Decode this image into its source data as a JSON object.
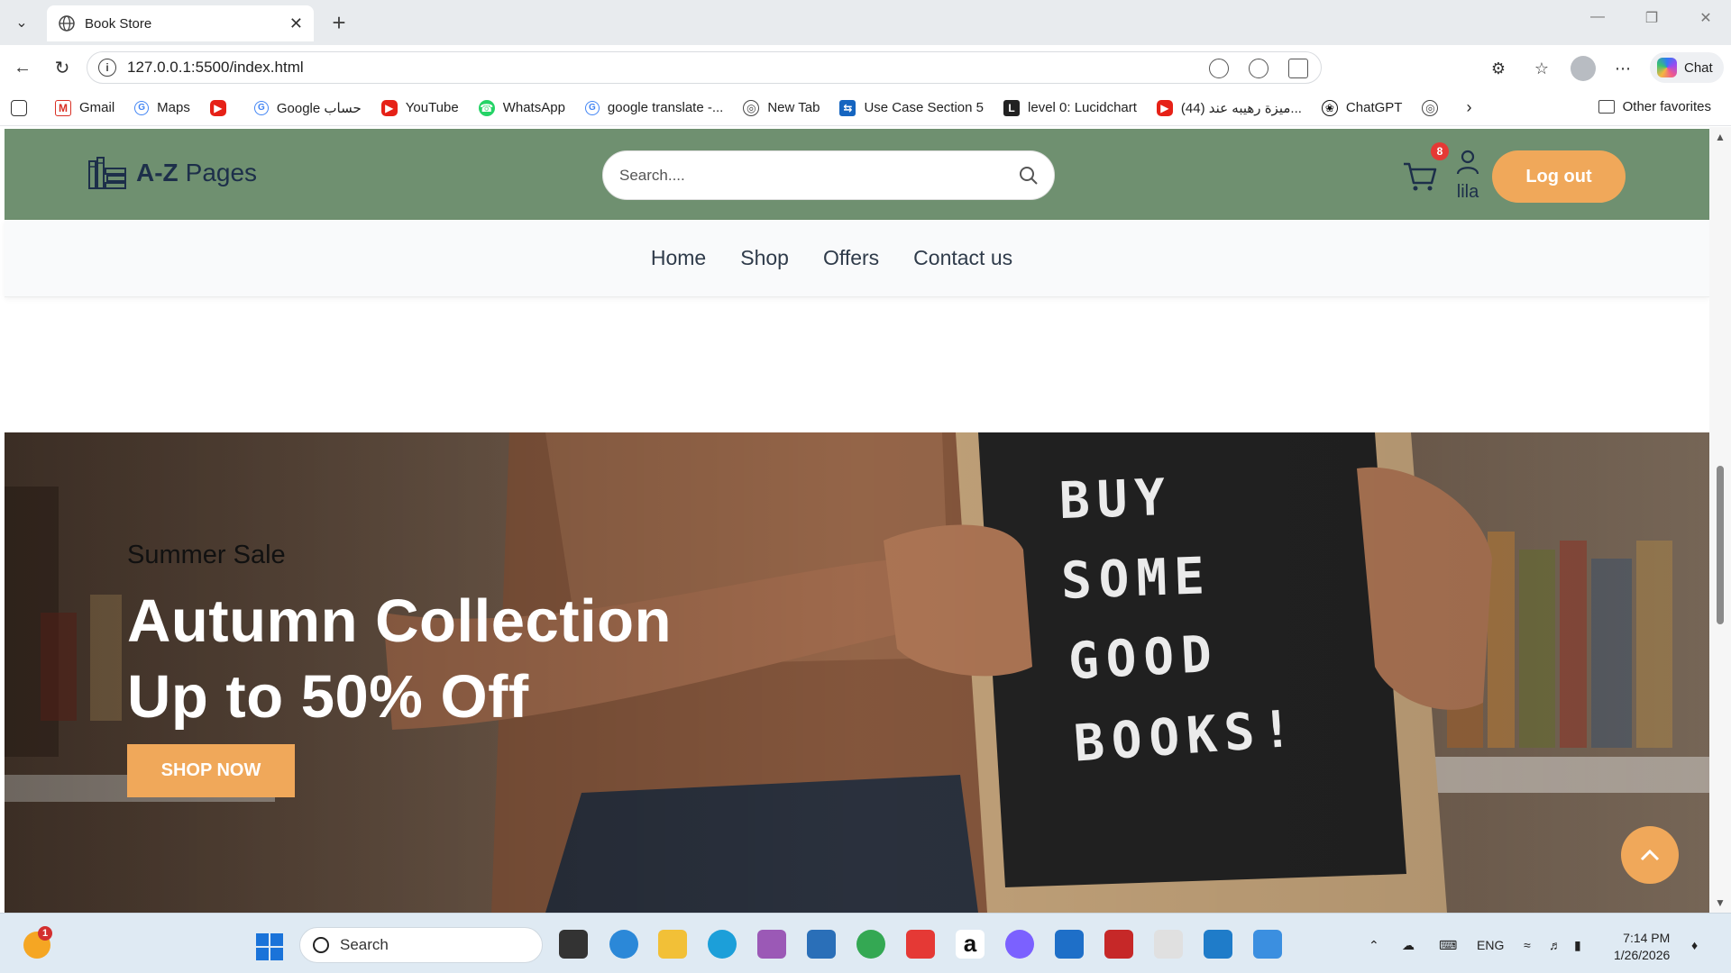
{
  "browser": {
    "tab_title": "Book Store",
    "url": "127.0.0.1:5500/index.html",
    "chat_label": "Chat",
    "bookmarks": [
      {
        "label": "Gmail",
        "icon": "gmail-icon"
      },
      {
        "label": "Maps",
        "icon": "google-icon"
      },
      {
        "label": "",
        "icon": "youtube-icon"
      },
      {
        "label": "Google حساب",
        "icon": "google-icon"
      },
      {
        "label": "YouTube",
        "icon": "youtube-icon"
      },
      {
        "label": "WhatsApp",
        "icon": "whatsapp-icon"
      },
      {
        "label": "google translate -...",
        "icon": "google-icon"
      },
      {
        "label": "New Tab",
        "icon": "globe-icon"
      },
      {
        "label": "Use Case Section 5",
        "icon": "usecase-icon"
      },
      {
        "label": "level 0: Lucidchart",
        "icon": "lucidchart-icon"
      },
      {
        "label": "(44) ميزة رهيبه عند...",
        "icon": "youtube-icon"
      },
      {
        "label": "ChatGPT",
        "icon": "chatgpt-icon"
      },
      {
        "label": "",
        "icon": "globe-icon"
      }
    ],
    "other_favorites": "Other favorites"
  },
  "site": {
    "brand_a": "A-Z",
    "brand_b": "Pages",
    "search_placeholder": "Search....",
    "cart_count": "8",
    "username": "lila",
    "logout_label": "Log out",
    "nav": [
      "Home",
      "Shop",
      "Offers",
      "Contact us"
    ]
  },
  "hero": {
    "eyebrow": "Summer Sale",
    "headline_line1": "Autumn Collection",
    "headline_line2": "Up to 50% Off",
    "cta": "SHOP NOW",
    "board_lines": [
      "BUY",
      "SOME",
      "GOOD",
      "BOOKS!"
    ]
  },
  "taskbar": {
    "search_placeholder": "Search",
    "weather_badge": "1",
    "language": "ENG",
    "time": "7:14 PM",
    "date": "1/26/2026"
  },
  "colors": {
    "header_green": "#6f9070",
    "accent_orange": "#f0a85a",
    "brand_navy": "#1d2f4a"
  }
}
